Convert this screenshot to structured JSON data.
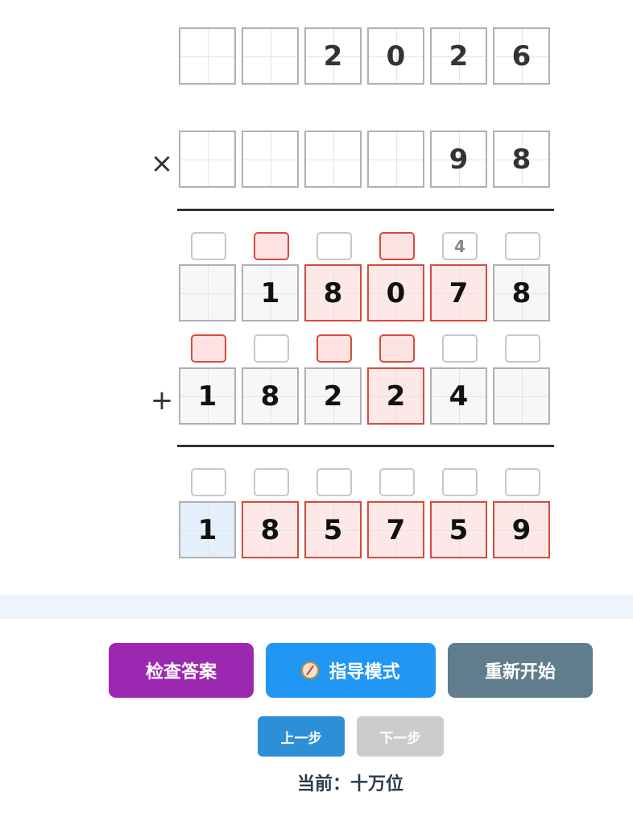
{
  "puzzle": {
    "multiplicand": [
      "",
      "",
      "2",
      "0",
      "2",
      "6"
    ],
    "multiplier_symbol": "×",
    "multiplier": [
      "",
      "",
      "",
      "",
      "9",
      "8"
    ],
    "partial1_carries": [
      "",
      "",
      "",
      "",
      "4",
      ""
    ],
    "partial1": [
      "",
      "1",
      "8",
      "0",
      "7",
      "8"
    ],
    "plus_symbol": "+",
    "partial2_carries": [
      "",
      "",
      "",
      "",
      "",
      ""
    ],
    "partial2": [
      "1",
      "8",
      "2",
      "2",
      "4",
      ""
    ],
    "result_carries": [
      "",
      "",
      "",
      "",
      "",
      ""
    ],
    "result": [
      "1",
      "8",
      "5",
      "7",
      "5",
      "9"
    ],
    "highlight_colors": {
      "error_border": "#d9493b",
      "error_fill": "#fde8e8",
      "active_fill": "#e3f0fb"
    }
  },
  "buttons": {
    "check": "检查答案",
    "guide": "指导模式",
    "guide_icon": "compass-icon",
    "restart": "重新开始",
    "prev": "上一步",
    "next": "下一步",
    "colors": {
      "check": "#9c27b0",
      "guide": "#2196f3",
      "restart": "#607d8b",
      "prev": "#2d8fd6",
      "next": "#cccccc"
    }
  },
  "status": {
    "label": "当前：",
    "value": "十万位"
  }
}
